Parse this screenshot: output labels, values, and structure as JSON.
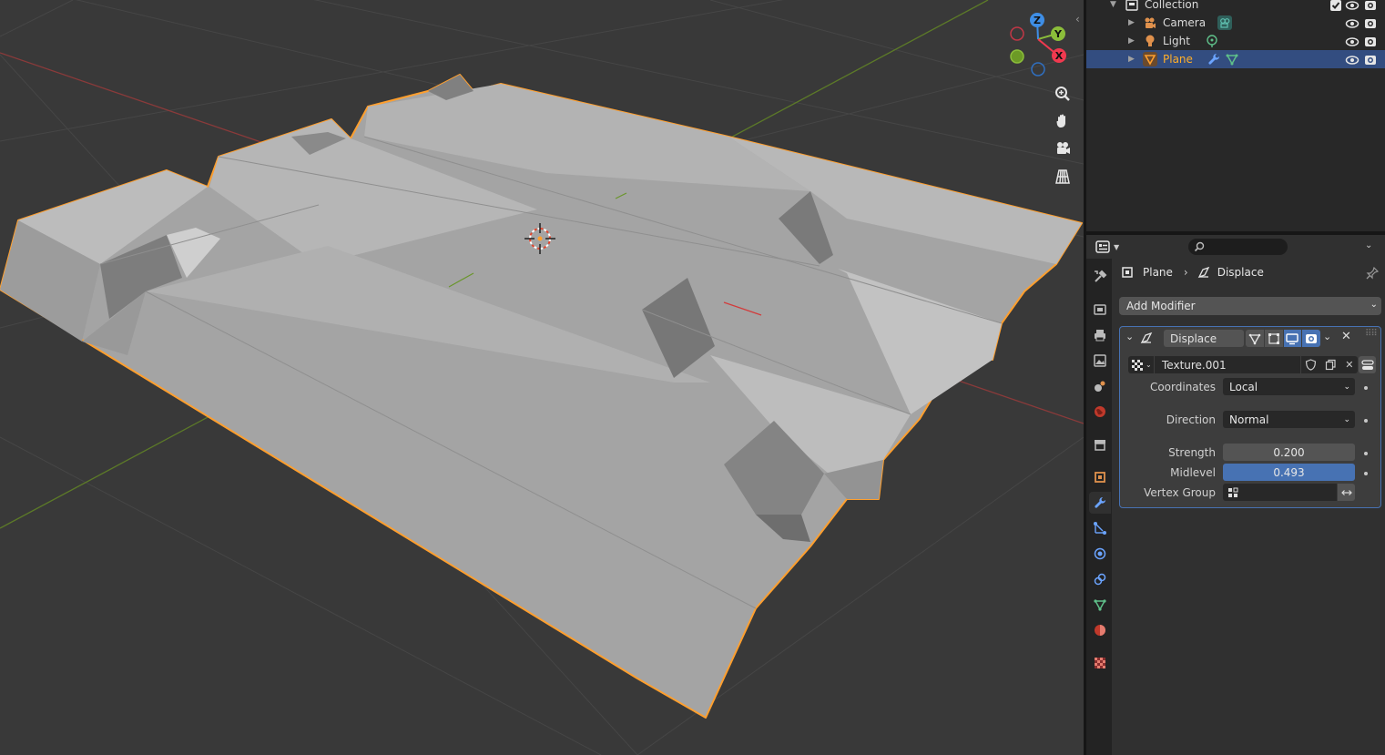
{
  "outliner": {
    "rows": [
      {
        "label": "Collection"
      },
      {
        "label": "Camera"
      },
      {
        "label": "Light"
      },
      {
        "label": "Plane"
      }
    ]
  },
  "properties": {
    "search_placeholder": "",
    "breadcrumb": {
      "object": "Plane",
      "modifier": "Displace"
    },
    "add_modifier_label": "Add Modifier",
    "modifier": {
      "name": "Displace",
      "texture": "Texture.001",
      "coordinates_label": "Coordinates",
      "coordinates_value": "Local",
      "direction_label": "Direction",
      "direction_value": "Normal",
      "strength_label": "Strength",
      "strength_value": "0.200",
      "midlevel_label": "Midlevel",
      "midlevel_value": "0.493",
      "vertex_group_label": "Vertex Group",
      "vertex_group_value": ""
    }
  },
  "gizmo": {
    "x": "X",
    "y": "Y",
    "z": "Z"
  },
  "colors": {
    "selection_outline": "#ff9f2e",
    "active_blue": "#4772b3",
    "x_axis": "#f0394f",
    "y_axis": "#8bbd3a",
    "z_axis": "#3e8ee6"
  }
}
